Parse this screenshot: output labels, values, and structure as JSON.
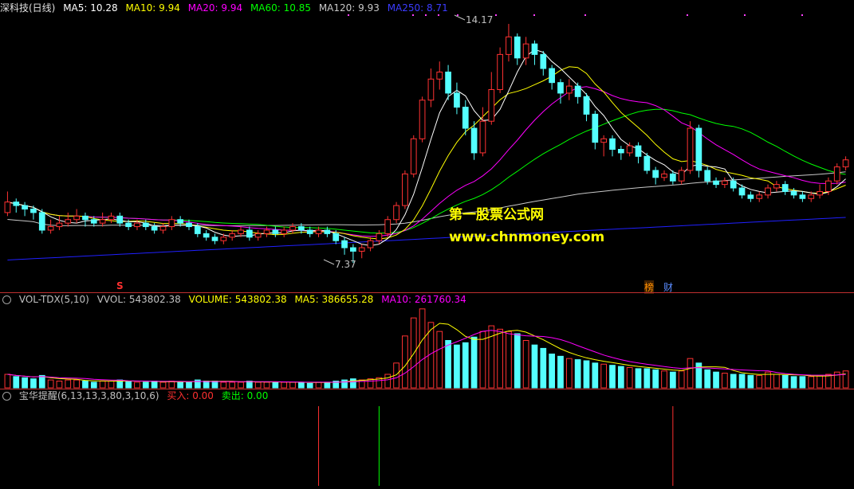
{
  "main_header": {
    "title": "深科技(日线)",
    "ma5": "MA5: 10.28",
    "ma10": "MA10: 9.94",
    "ma20": "MA20: 9.94",
    "ma60": "MA60: 10.85",
    "ma120": "MA120: 9.93",
    "ma250": "MA250: 8.71"
  },
  "price_labels": {
    "high": "14.17",
    "low": "7.37"
  },
  "watermark": {
    "line1": "第一股票公式网",
    "line2": "www.chnmoney.com"
  },
  "event_marks": {
    "s_mark": "S",
    "bang": "榜",
    "cai": "财"
  },
  "vol_header": {
    "name": "VOL-TDX(5,10)",
    "vvol": "VVOL: 543802.38",
    "volume": "VOLUME: 543802.38",
    "ma5": "MA5: 386655.28",
    "ma10": "MA10: 261760.34"
  },
  "ind_header": {
    "name": "宝华提醒(6,13,13,3,80,3,10,6)",
    "buy": "买入: 0.00",
    "sell": "卖出: 0.00"
  },
  "colors": {
    "up": "#ff3232",
    "down": "#54ffff",
    "ma5": "#ffffff",
    "ma10": "#ffff00",
    "ma20": "#ff00ff",
    "ma60": "#00ff00",
    "ma120": "#c8c8c8",
    "ma250": "#2020ff",
    "signal_red": "#ff3030",
    "signal_green": "#00ff00"
  },
  "chart_data": {
    "type": "candlestick",
    "price_axis": {
      "min": 7.37,
      "max": 14.17
    },
    "candles": [
      [
        8.8,
        9.1,
        9.4,
        8.7
      ],
      [
        9.1,
        9.0,
        9.2,
        8.8
      ],
      [
        9.0,
        8.9,
        9.1,
        8.7
      ],
      [
        8.9,
        8.8,
        9.0,
        8.6
      ],
      [
        8.8,
        8.3,
        8.9,
        8.2
      ],
      [
        8.3,
        8.4,
        8.6,
        8.2
      ],
      [
        8.4,
        8.5,
        8.7,
        8.3
      ],
      [
        8.5,
        8.6,
        8.8,
        8.4
      ],
      [
        8.6,
        8.7,
        8.9,
        8.5
      ],
      [
        8.7,
        8.6,
        8.8,
        8.4
      ],
      [
        8.6,
        8.5,
        8.7,
        8.4
      ],
      [
        8.5,
        8.6,
        8.8,
        8.4
      ],
      [
        8.6,
        8.7,
        8.8,
        8.5
      ],
      [
        8.7,
        8.5,
        8.8,
        8.4
      ],
      [
        8.5,
        8.4,
        8.6,
        8.3
      ],
      [
        8.4,
        8.5,
        8.6,
        8.3
      ],
      [
        8.5,
        8.4,
        8.6,
        8.3
      ],
      [
        8.4,
        8.3,
        8.5,
        8.2
      ],
      [
        8.3,
        8.4,
        8.5,
        8.2
      ],
      [
        8.4,
        8.6,
        8.7,
        8.3
      ],
      [
        8.6,
        8.5,
        8.7,
        8.4
      ],
      [
        8.5,
        8.4,
        8.6,
        8.3
      ],
      [
        8.4,
        8.2,
        8.5,
        8.1
      ],
      [
        8.2,
        8.1,
        8.3,
        8.0
      ],
      [
        8.1,
        8.0,
        8.2,
        7.9
      ],
      [
        8.0,
        8.1,
        8.2,
        7.9
      ],
      [
        8.1,
        8.2,
        8.3,
        8.0
      ],
      [
        8.2,
        8.3,
        8.4,
        8.1
      ],
      [
        8.3,
        8.1,
        8.4,
        8.0
      ],
      [
        8.1,
        8.2,
        8.3,
        8.0
      ],
      [
        8.2,
        8.3,
        8.4,
        8.1
      ],
      [
        8.3,
        8.2,
        8.4,
        8.1
      ],
      [
        8.2,
        8.3,
        8.4,
        8.1
      ],
      [
        8.3,
        8.4,
        8.5,
        8.2
      ],
      [
        8.4,
        8.3,
        8.5,
        8.2
      ],
      [
        8.3,
        8.2,
        8.4,
        8.1
      ],
      [
        8.2,
        8.3,
        8.4,
        8.1
      ],
      [
        8.3,
        8.2,
        8.4,
        8.1
      ],
      [
        8.2,
        8.0,
        8.3,
        7.9
      ],
      [
        8.0,
        7.8,
        8.1,
        7.6
      ],
      [
        7.8,
        7.7,
        7.9,
        7.37
      ],
      [
        7.7,
        7.8,
        7.9,
        7.5
      ],
      [
        7.8,
        8.0,
        8.1,
        7.7
      ],
      [
        8.0,
        8.2,
        8.3,
        7.9
      ],
      [
        8.2,
        8.6,
        8.7,
        8.1
      ],
      [
        8.6,
        9.0,
        9.1,
        8.5
      ],
      [
        9.0,
        9.9,
        10.0,
        8.9
      ],
      [
        9.9,
        10.9,
        11.0,
        9.8
      ],
      [
        10.9,
        12.0,
        12.1,
        10.8
      ],
      [
        12.0,
        12.6,
        12.9,
        11.8
      ],
      [
        12.6,
        12.8,
        13.1,
        12.3
      ],
      [
        12.8,
        12.2,
        13.0,
        12.0
      ],
      [
        12.2,
        11.8,
        12.5,
        11.6
      ],
      [
        11.8,
        11.2,
        12.0,
        11.0
      ],
      [
        11.2,
        10.5,
        11.4,
        10.3
      ],
      [
        10.5,
        11.4,
        11.8,
        10.4
      ],
      [
        11.4,
        12.3,
        12.8,
        11.3
      ],
      [
        12.3,
        13.3,
        13.5,
        12.2
      ],
      [
        13.3,
        13.8,
        14.17,
        13.1
      ],
      [
        13.8,
        13.2,
        13.9,
        13.0
      ],
      [
        13.2,
        13.6,
        13.8,
        13.0
      ],
      [
        13.6,
        13.3,
        13.7,
        13.0
      ],
      [
        13.3,
        12.9,
        13.4,
        12.7
      ],
      [
        12.9,
        12.5,
        13.0,
        12.3
      ],
      [
        12.5,
        12.2,
        12.6,
        11.9
      ],
      [
        12.2,
        12.4,
        12.6,
        12.0
      ],
      [
        12.4,
        12.1,
        12.5,
        11.9
      ],
      [
        12.1,
        11.6,
        12.2,
        11.4
      ],
      [
        11.6,
        10.8,
        11.7,
        10.6
      ],
      [
        10.8,
        10.9,
        11.0,
        10.4
      ],
      [
        10.9,
        10.6,
        11.0,
        10.4
      ],
      [
        10.6,
        10.5,
        10.7,
        10.3
      ],
      [
        10.5,
        10.7,
        10.8,
        10.4
      ],
      [
        10.7,
        10.4,
        10.8,
        10.2
      ],
      [
        10.4,
        10.0,
        10.5,
        9.9
      ],
      [
        10.0,
        9.8,
        10.1,
        9.6
      ],
      [
        9.8,
        9.9,
        10.0,
        9.7
      ],
      [
        9.9,
        9.7,
        10.0,
        9.6
      ],
      [
        9.7,
        10.0,
        10.1,
        9.6
      ],
      [
        10.0,
        11.2,
        11.4,
        9.9
      ],
      [
        11.2,
        10.0,
        11.3,
        9.8
      ],
      [
        10.0,
        9.7,
        10.1,
        9.6
      ],
      [
        9.7,
        9.6,
        9.8,
        9.5
      ],
      [
        9.6,
        9.7,
        9.8,
        9.5
      ],
      [
        9.7,
        9.5,
        9.8,
        9.4
      ],
      [
        9.5,
        9.3,
        9.6,
        9.2
      ],
      [
        9.3,
        9.2,
        9.4,
        9.1
      ],
      [
        9.2,
        9.3,
        9.4,
        9.1
      ],
      [
        9.3,
        9.5,
        9.6,
        9.2
      ],
      [
        9.5,
        9.6,
        9.7,
        9.4
      ],
      [
        9.6,
        9.4,
        9.7,
        9.3
      ],
      [
        9.4,
        9.3,
        9.5,
        9.2
      ],
      [
        9.3,
        9.2,
        9.4,
        9.1
      ],
      [
        9.2,
        9.3,
        9.4,
        9.1
      ],
      [
        9.3,
        9.4,
        9.6,
        9.2
      ],
      [
        9.4,
        9.7,
        9.8,
        9.3
      ],
      [
        9.7,
        10.1,
        10.2,
        9.6
      ],
      [
        10.1,
        10.3,
        10.4,
        10.0
      ]
    ],
    "volume": [
      0.12,
      0.1,
      0.09,
      0.08,
      0.11,
      0.07,
      0.06,
      0.07,
      0.07,
      0.06,
      0.05,
      0.06,
      0.06,
      0.07,
      0.06,
      0.05,
      0.05,
      0.06,
      0.05,
      0.06,
      0.05,
      0.05,
      0.07,
      0.06,
      0.06,
      0.05,
      0.05,
      0.05,
      0.06,
      0.05,
      0.05,
      0.05,
      0.05,
      0.05,
      0.05,
      0.04,
      0.05,
      0.05,
      0.06,
      0.07,
      0.08,
      0.07,
      0.08,
      0.09,
      0.12,
      0.22,
      0.46,
      0.62,
      0.7,
      0.58,
      0.5,
      0.42,
      0.38,
      0.4,
      0.45,
      0.5,
      0.55,
      0.52,
      0.5,
      0.48,
      0.42,
      0.38,
      0.35,
      0.3,
      0.28,
      0.26,
      0.25,
      0.24,
      0.22,
      0.21,
      0.2,
      0.19,
      0.18,
      0.17,
      0.17,
      0.16,
      0.15,
      0.14,
      0.15,
      0.26,
      0.22,
      0.16,
      0.14,
      0.13,
      0.12,
      0.12,
      0.11,
      0.11,
      0.14,
      0.12,
      0.11,
      0.1,
      0.1,
      0.1,
      0.11,
      0.12,
      0.14,
      0.15
    ],
    "signals": {
      "buy": [
        36,
        77
      ],
      "sell": [
        43
      ]
    }
  }
}
